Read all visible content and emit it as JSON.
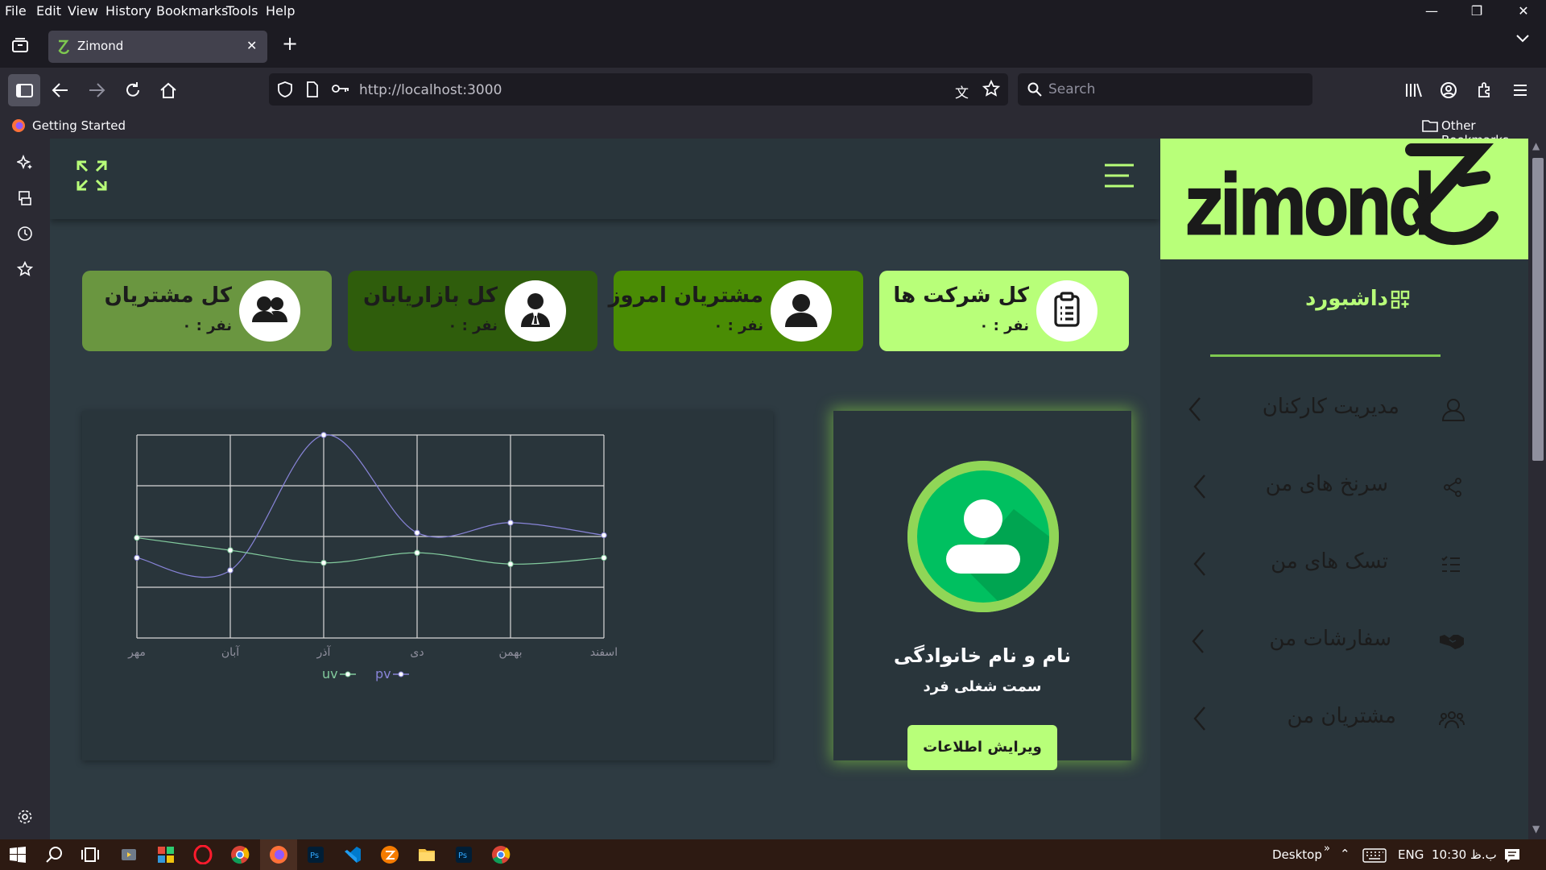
{
  "menubar": {
    "items": [
      "File",
      "Edit",
      "View",
      "History",
      "Bookmarks",
      "Tools",
      "Help"
    ]
  },
  "tab": {
    "title": "Zimond"
  },
  "url": "http://localhost:3000",
  "search": {
    "placeholder": "Search"
  },
  "bookmarks": {
    "getting_started": "Getting Started",
    "other": "Other Bookmarks"
  },
  "stats": [
    {
      "title": "کل مشتریان",
      "value": "نفر : ۰",
      "bg": "#6a9640"
    },
    {
      "title": "کل بازاریابان",
      "value": "نفر : ۰",
      "bg": "#2f5d0c"
    },
    {
      "title": "مشتریان امروز",
      "value": "نفر : ۰",
      "bg": "#4a8c04"
    },
    {
      "title": "کل شرکت ها",
      "value": "نفر : ۰",
      "bg": "#b8ff79"
    }
  ],
  "profile": {
    "name": "نام و نام خانوادگی",
    "role": "سمت شغلی فرد",
    "edit_button": "ویرایش اطلاعات"
  },
  "brand": {
    "logo_text": "zimond",
    "accent": "#b8ff79"
  },
  "nav": {
    "dashboard": "داشبورد",
    "items": [
      {
        "label": "مدیریت کارکنان",
        "icon": "user-icon"
      },
      {
        "label": "سرنخ های من",
        "icon": "share-icon"
      },
      {
        "label": "تسک های من",
        "icon": "checklist-icon"
      },
      {
        "label": "سفارشات من",
        "icon": "handshake-icon"
      },
      {
        "label": "مشتریان من",
        "icon": "users-icon"
      }
    ]
  },
  "taskbar": {
    "desktop": "Desktop",
    "lang": "ENG",
    "clock": "10:30 ب.ظ"
  },
  "chart_data": {
    "type": "line",
    "categories": [
      "مهر",
      "آبان",
      "آذر",
      "دی",
      "بهمن",
      "اسفند"
    ],
    "series": [
      {
        "name": "pv",
        "color": "#8884d8",
        "values": [
          3200,
          2700,
          8100,
          4200,
          4600,
          4100
        ]
      },
      {
        "name": "uv",
        "color": "#82ca9d",
        "values": [
          4000,
          3500,
          3000,
          3400,
          2950,
          3200
        ]
      }
    ],
    "ylim": [
      0,
      8100
    ],
    "grid": true,
    "legend": "bottom"
  }
}
